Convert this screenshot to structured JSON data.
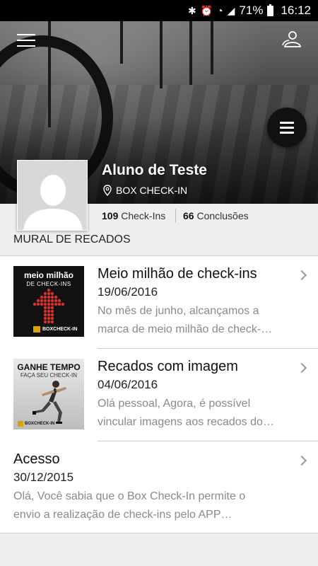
{
  "status_bar": {
    "battery": "71%",
    "time": "16:12"
  },
  "profile": {
    "name": "Aluno de Teste",
    "location": "BOX CHECK-IN",
    "checkins_count": "109",
    "checkins_label": "Check-Ins",
    "conclusions_count": "66",
    "conclusions_label": "Conclusões"
  },
  "section": {
    "title": "MURAL DE RECADOS"
  },
  "messages": [
    {
      "title": "Meio milhão de check-ins",
      "date": "19/06/2016",
      "preview_line1": "No mês de junho, alcançamos a",
      "preview_line2": "marca de meio milhão de check-…",
      "thumb": {
        "heading": "meio milhão",
        "subheading": "DE CHECK-INS",
        "logo_text": "BOXCHECK-IN"
      }
    },
    {
      "title": "Recados com imagem",
      "date": "04/06/2016",
      "preview_line1": "Olá pessoal, Agora, é possível",
      "preview_line2": "vincular imagens aos recados do…",
      "thumb": {
        "heading": "GANHE TEMPO",
        "subheading": "FAÇA SEU CHECK-IN",
        "logo_text": "BOXCHECK-IN"
      }
    },
    {
      "title": "Acesso",
      "date": "30/12/2015",
      "preview_line1": "Olá, Você sabia que o Box Check-In permite o",
      "preview_line2": "envio a realização de check-ins pelo APP…"
    }
  ],
  "icons": {
    "menu": "hamburger-menu-icon",
    "user_switch": "users-icon",
    "fab": "menu-fab-icon",
    "location": "map-pin-icon",
    "chevron": "chevron-right-icon"
  },
  "colors": {
    "status_bar": "#000000",
    "fab": "#111111",
    "accent_logo": "#d9a300",
    "arrow_red": "#d8302a"
  }
}
